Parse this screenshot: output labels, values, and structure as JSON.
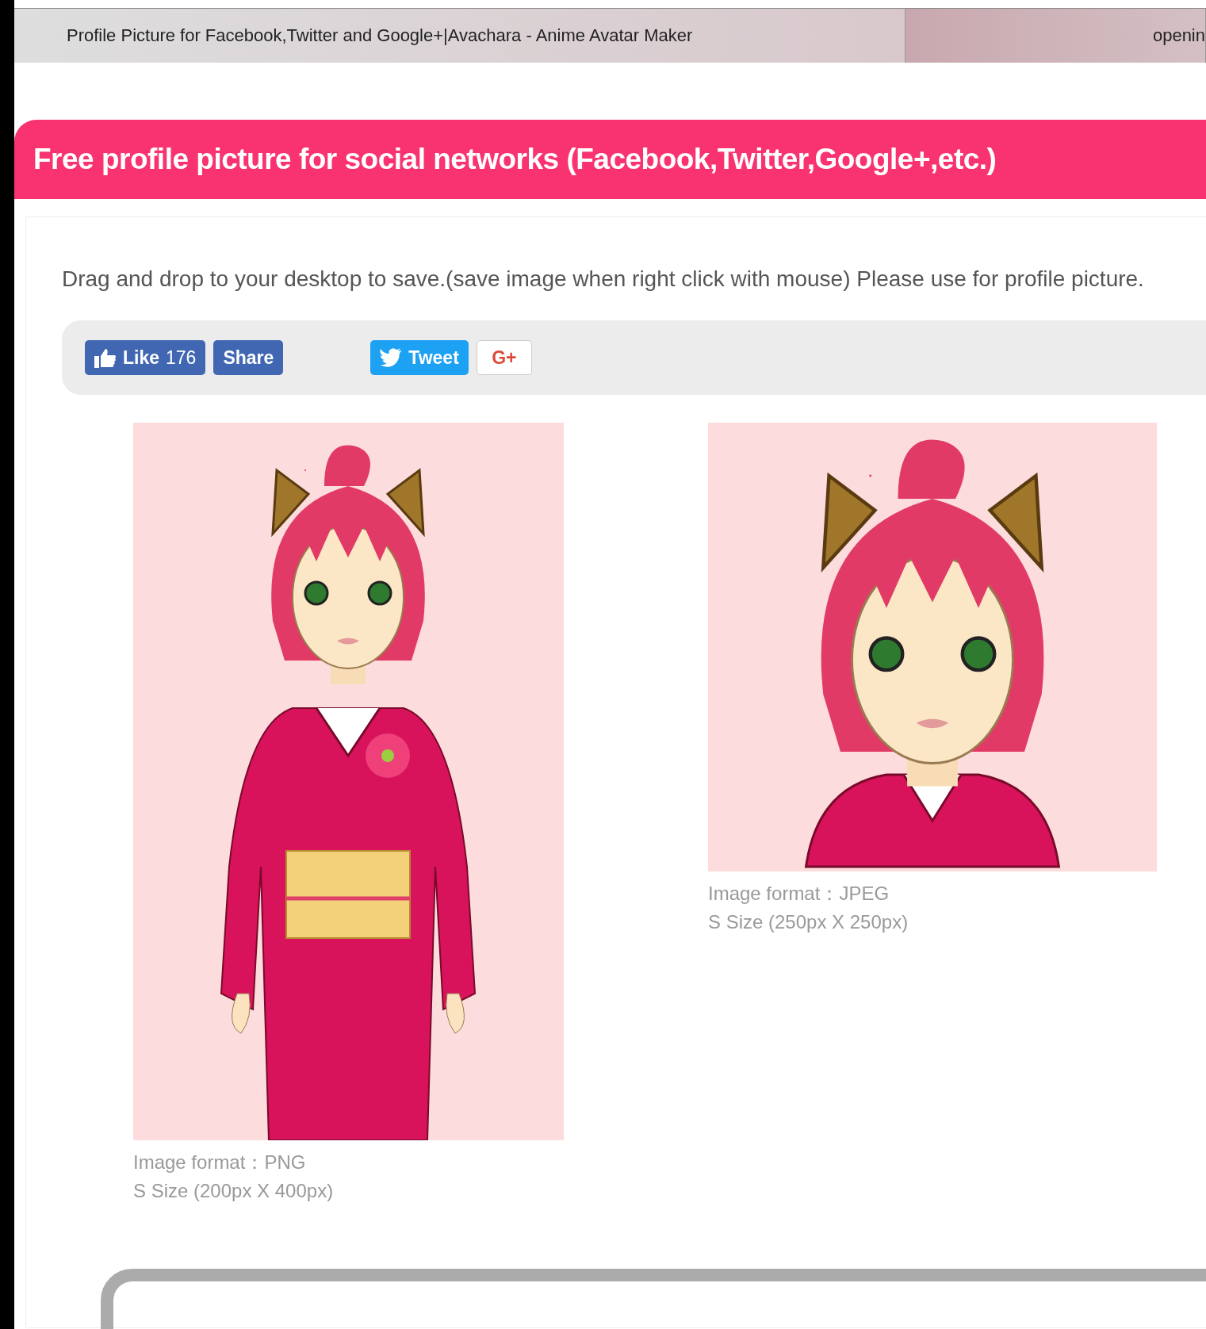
{
  "browser_tabs": [
    {
      "title": "Profile Picture for Facebook,Twitter and Google+|Avachara - Anime Avatar Maker",
      "selected": true
    },
    {
      "title": "openin",
      "selected": false
    }
  ],
  "header": {
    "title": "Free profile picture for social networks (Facebook,Twitter,Google+,etc.)"
  },
  "instructions": "Drag and drop to your desktop to save.(save image when right click with mouse) Please use for profile picture.",
  "social_buttons": [
    {
      "kind": "like",
      "label": "Like",
      "count": "176"
    },
    {
      "kind": "share",
      "label": "Share"
    },
    {
      "kind": "tweet",
      "label": "Tweet"
    },
    {
      "kind": "gplus",
      "label": "G+"
    }
  ],
  "images": [
    {
      "kind": "full",
      "format": "Image format：PNG",
      "size": "S Size (200px X 400px)"
    },
    {
      "kind": "bust",
      "format": "Image format：JPEG",
      "size": "S Size (250px X 250px)"
    }
  ]
}
